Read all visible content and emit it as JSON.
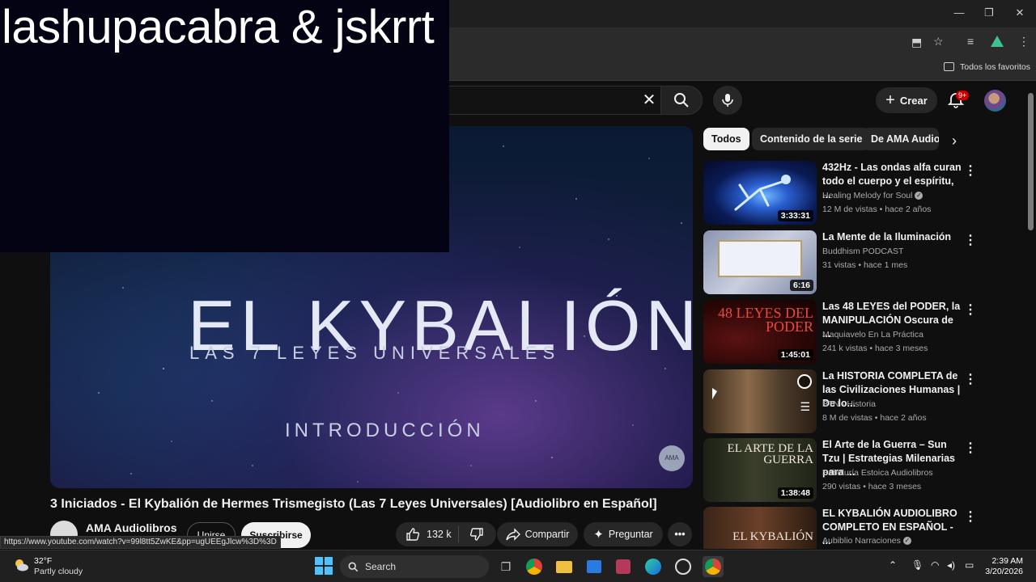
{
  "overlay": {
    "text": "lashupacabra & jskrrt"
  },
  "browser": {
    "bookmarks_label": "Todos los favoritos",
    "window_controls": {
      "minimize": "—",
      "maximize": "❐",
      "close": "✕"
    }
  },
  "header": {
    "search_clear": "✕",
    "create_label": "Crear",
    "notifications_badge": "9+"
  },
  "video": {
    "thumb_title": "EL KYBALIÓN",
    "thumb_subtitle": "LAS 7 LEYES UNIVERSALES",
    "thumb_intro": "INTRODUCCIÓN",
    "logo": "AMA",
    "title": "3 Iniciados - El Kybalión de Hermes Trismegisto (Las 7 Leyes Universales) [Audiolibro en Español]",
    "channel": "AMA Audiolibros",
    "join_label": "Unirse",
    "subscribe_label": "Suscribirse",
    "likes": "132 k",
    "share_label": "Compartir",
    "ask_label": "Preguntar",
    "more_label": "•••",
    "hover_url": "https://www.youtube.com/watch?v=99l8tt5ZwKE&pp=ugUEEgJlcw%3D%3D"
  },
  "chips": [
    "Todos",
    "Contenido de la serie",
    "De AMA Audiolibros"
  ],
  "recommendations": [
    {
      "title": "432Hz - Las ondas alfa curan todo el cuerpo y el espíritu, ...",
      "channel": "Healing Melody for Soul",
      "verified": true,
      "meta": "12 M de vistas • hace 2 años",
      "duration": "3:33:31",
      "thumb_text": ""
    },
    {
      "title": "La Mente de la Iluminación",
      "channel": "Buddhism PODCAST",
      "verified": false,
      "meta": "31 vistas • hace 1 mes",
      "duration": "6:16",
      "thumb_text": ""
    },
    {
      "title": "Las 48 LEYES del PODER, la MANIPULACIÓN Oscura de ...",
      "channel": "Maquiavelo En La Práctica",
      "verified": false,
      "meta": "241 k vistas • hace 3 meses",
      "duration": "1:45:01",
      "thumb_text": "48 LEYES DEL PODER"
    },
    {
      "title": "La HISTORIA COMPLETA de las Civilizaciones Humanas | De lo...",
      "channel": "BTN - Historia",
      "verified": false,
      "meta": "8 M de vistas • hace 2 años",
      "duration": "",
      "thumb_text": ""
    },
    {
      "title": "El Arte de la Guerra – Sun Tzu | Estrategias Milenarias para ...",
      "channel": "Sabiduría Estoica Audiolibros",
      "verified": false,
      "meta": "290 vistas • hace 3 meses",
      "duration": "1:38:48",
      "thumb_text": "EL ARTE DE LA GUERRA"
    },
    {
      "title": "EL KYBALIÓN AUDIOLIBRO COMPLETO EN ESPAÑOL - ...",
      "channel": "Aubiblio Narraciones",
      "verified": true,
      "meta": "",
      "duration": "",
      "thumb_text": "EL KYBALIÓN"
    }
  ],
  "taskbar": {
    "weather_temp": "32°F",
    "weather_desc": "Partly cloudy",
    "search_label": "Search",
    "time": "2:39 AM",
    "date": "3/20/2026"
  }
}
